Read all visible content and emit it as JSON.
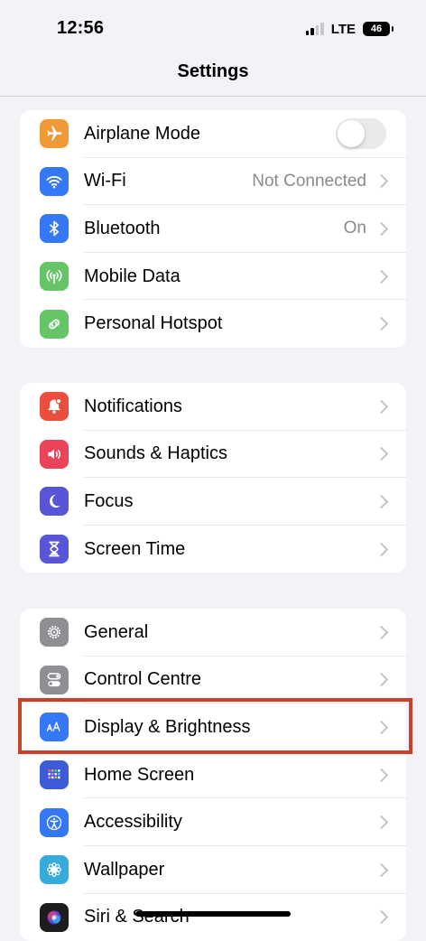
{
  "status_bar": {
    "time": "12:56",
    "network": "LTE",
    "battery": "46"
  },
  "nav": {
    "title": "Settings"
  },
  "groups": [
    {
      "items": [
        {
          "label": "Airplane Mode",
          "icon": "airplane-icon",
          "color": "#f09a37",
          "toggle": false
        },
        {
          "label": "Wi-Fi",
          "detail": "Not Connected",
          "icon": "wifi-icon",
          "color": "#3478f6"
        },
        {
          "label": "Bluetooth",
          "detail": "On",
          "icon": "bluetooth-icon",
          "color": "#3478f6"
        },
        {
          "label": "Mobile Data",
          "icon": "antenna-icon",
          "color": "#65c466"
        },
        {
          "label": "Personal Hotspot",
          "icon": "hotspot-icon",
          "color": "#65c466"
        }
      ]
    },
    {
      "items": [
        {
          "label": "Notifications",
          "icon": "bell-icon",
          "color": "#eb4e3d"
        },
        {
          "label": "Sounds & Haptics",
          "icon": "speaker-icon",
          "color": "#eb445a"
        },
        {
          "label": "Focus",
          "icon": "moon-icon",
          "color": "#5856d6"
        },
        {
          "label": "Screen Time",
          "icon": "hourglass-icon",
          "color": "#5856d6"
        }
      ]
    },
    {
      "items": [
        {
          "label": "General",
          "icon": "gear-icon",
          "color": "#8e8e93"
        },
        {
          "label": "Control Centre",
          "icon": "switches-icon",
          "color": "#8e8e93"
        },
        {
          "label": "Display & Brightness",
          "icon": "text-size-icon",
          "color": "#3478f6"
        },
        {
          "label": "Home Screen",
          "icon": "app-grid-icon",
          "color": "#3d5bd9"
        },
        {
          "label": "Accessibility",
          "icon": "accessibility-icon",
          "color": "#3478f6"
        },
        {
          "label": "Wallpaper",
          "icon": "flower-icon",
          "color": "#35aadc"
        },
        {
          "label": "Siri & Search",
          "icon": "siri-icon",
          "color": "#1c1c1e"
        }
      ]
    }
  ]
}
